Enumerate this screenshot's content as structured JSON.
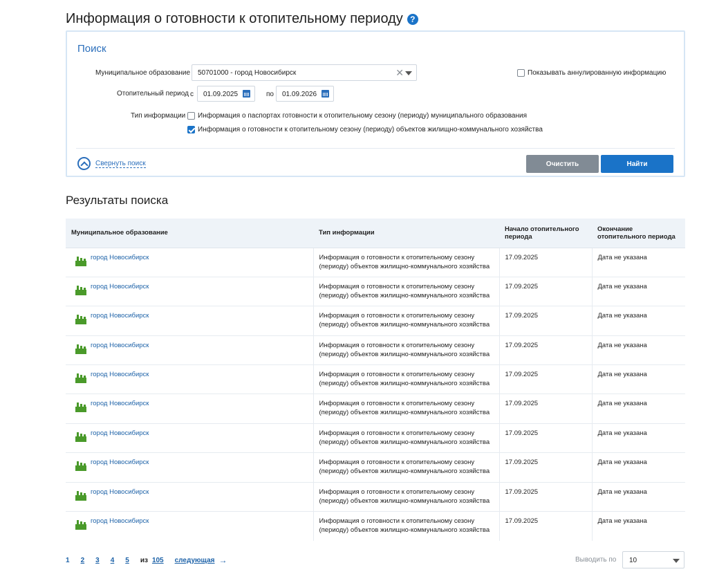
{
  "page": {
    "title": "Информация о готовности к отопительному периоду",
    "help_symbol": "?"
  },
  "search": {
    "title": "Поиск",
    "municipality_label": "Муниципальное образование",
    "municipality_value": "50701000 - город Новосибирск",
    "clear_symbol": "✕",
    "period_label": "Отопительный период",
    "from_label": "с",
    "from_date": "01.09.2025",
    "to_label": "по",
    "to_date": "01.09.2026",
    "show_cancelled_label": "Показывать аннулированную информацию",
    "show_cancelled_checked": false,
    "info_type_label": "Тип информации",
    "info_types": [
      {
        "label": "Информация о паспортах готовности к отопительному сезону (периоду) муниципального образования",
        "checked": false
      },
      {
        "label": "Информация о готовности к отопительному сезону (периоду) объектов жилищно-коммунального хозяйства",
        "checked": true
      }
    ],
    "collapse_label": "Свернуть поиск",
    "clear_button": "Очистить",
    "find_button": "Найти"
  },
  "results": {
    "title": "Результаты поиска",
    "columns": [
      "Муниципальное образование",
      "Тип информации",
      "Начало отопительного периода",
      "Окончание отопительного периода"
    ],
    "rows": [
      {
        "municipality": "город Новосибирск",
        "type": "Информация о готовности к отопительному сезону (периоду) объектов жилищно-коммунального хозяйства",
        "start": "17.09.2025",
        "end": "Дата не указана"
      },
      {
        "municipality": "город Новосибирск",
        "type": "Информация о готовности к отопительному сезону (периоду) объектов жилищно-коммунального хозяйства",
        "start": "17.09.2025",
        "end": "Дата не указана"
      },
      {
        "municipality": "город Новосибирск",
        "type": "Информация о готовности к отопительному сезону (периоду) объектов жилищно-коммунального хозяйства",
        "start": "17.09.2025",
        "end": "Дата не указана"
      },
      {
        "municipality": "город Новосибирск",
        "type": "Информация о готовности к отопительному сезону (периоду) объектов жилищно-коммунального хозяйства",
        "start": "17.09.2025",
        "end": "Дата не указана"
      },
      {
        "municipality": "город Новосибирск",
        "type": "Информация о готовности к отопительному сезону (периоду) объектов жилищно-коммунального хозяйства",
        "start": "17.09.2025",
        "end": "Дата не указана"
      },
      {
        "municipality": "город Новосибирск",
        "type": "Информация о готовности к отопительному сезону (периоду) объектов жилищно-коммунального хозяйства",
        "start": "17.09.2025",
        "end": "Дата не указана"
      },
      {
        "municipality": "город Новосибирск",
        "type": "Информация о готовности к отопительному сезону (периоду) объектов жилищно-коммунального хозяйства",
        "start": "17.09.2025",
        "end": "Дата не указана"
      },
      {
        "municipality": "город Новосибирск",
        "type": "Информация о готовности к отопительному сезону (периоду) объектов жилищно-коммунального хозяйства",
        "start": "17.09.2025",
        "end": "Дата не указана"
      },
      {
        "municipality": "город Новосибирск",
        "type": "Информация о готовности к отопительному сезону (периоду) объектов жилищно-коммунального хозяйства",
        "start": "17.09.2025",
        "end": "Дата не указана"
      },
      {
        "municipality": "город Новосибирск",
        "type": "Информация о готовности к отопительному сезону (периоду) объектов жилищно-коммунального хозяйства",
        "start": "17.09.2025",
        "end": "Дата не указана"
      }
    ]
  },
  "pagination": {
    "pages": [
      "1",
      "2",
      "3",
      "4",
      "5"
    ],
    "current_page": "1",
    "of_label": "из",
    "total_pages": "105",
    "next_label": "следующая",
    "next_arrow": "→",
    "per_page_label": "Выводить по",
    "per_page_value": "10"
  },
  "colors": {
    "accent": "#1a73c8",
    "link": "#1d62a8",
    "clear_button": "#818b95",
    "table_header_bg": "#eef3f8",
    "panel_border": "#d6e6f5",
    "factory_icon": "#4a9a2a"
  }
}
